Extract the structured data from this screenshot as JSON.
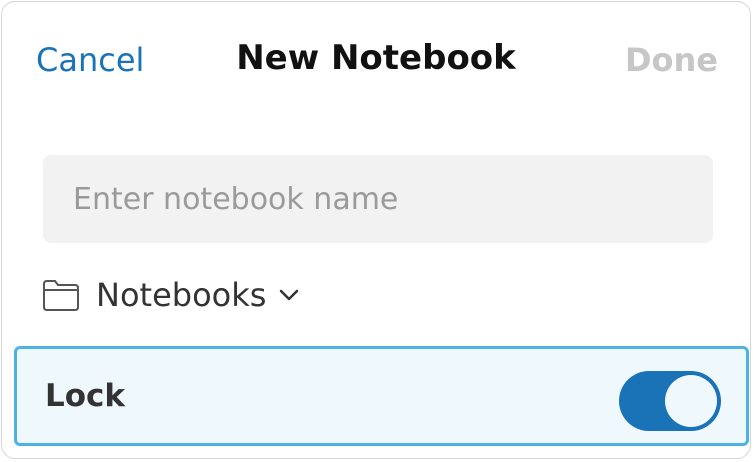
{
  "header": {
    "cancel_label": "Cancel",
    "title": "New Notebook",
    "done_label": "Done"
  },
  "name_field": {
    "value": "",
    "placeholder": "Enter notebook name"
  },
  "notebook_picker": {
    "icon": "folder-icon",
    "selected": "Notebooks",
    "chevron": "chevron-down-icon"
  },
  "lock": {
    "label": "Lock",
    "enabled": true
  },
  "colors": {
    "accent": "#1a73b6",
    "done_disabled": "#c6c6c6",
    "lock_row_border": "#4cb3e4",
    "lock_row_background": "#eff8fc"
  }
}
